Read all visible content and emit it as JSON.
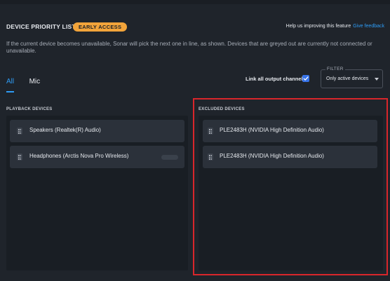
{
  "header": {
    "title": "DEVICE PRIORITY LIST",
    "badge": "EARLY ACCESS",
    "help_text": "Help us improving this feature",
    "feedback_link": "Give feedback"
  },
  "description": "If the current device becomes unavailable, Sonar will pick the next one in line, as shown. Devices that are greyed out are currently not connected or unavailable.",
  "tabs": [
    {
      "label": "All",
      "active": true
    },
    {
      "label": "Mic",
      "active": false
    }
  ],
  "link_channels": {
    "label": "Link all output channels",
    "checked": true
  },
  "filter": {
    "label": "FILTER",
    "selected": "Only active devices"
  },
  "playback": {
    "label": "PLAYBACK DEVICES",
    "devices": [
      {
        "name": "Speakers (Realtek(R) Audio)"
      },
      {
        "name": "Headphones (Arctis Nova Pro Wireless)"
      }
    ]
  },
  "excluded": {
    "label": "EXCLUDED DEVICES",
    "devices": [
      {
        "name": "PLE2483H (NVIDIA High Definition Audio)"
      },
      {
        "name": "PLE2483H (NVIDIA High Definition Audio)"
      }
    ]
  },
  "colors": {
    "background": "#1f242b",
    "panel": "#191e24",
    "card": "#2b313a",
    "accent": "#2e9cf5",
    "badge": "#f2a43a",
    "highlight": "#d9262b"
  },
  "icons": {
    "drag_handle": "drag-handle-icon",
    "checkbox_check": "check-icon",
    "filter_caret": "chevron-down-icon"
  }
}
